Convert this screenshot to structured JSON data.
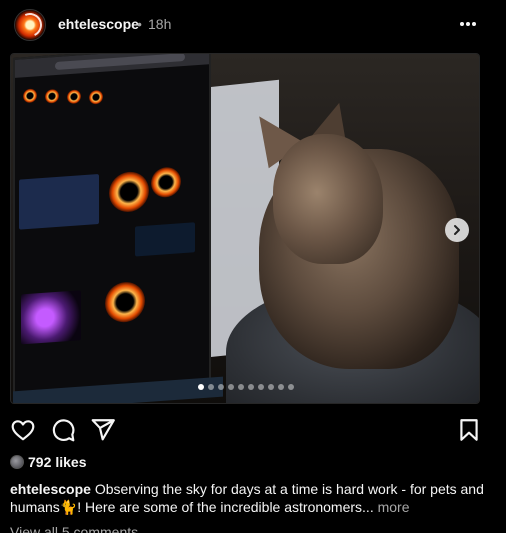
{
  "post": {
    "username": "ehtelescope",
    "separator": "•",
    "time": "18h",
    "likes_count": "792",
    "likes_word": "likes",
    "caption_username": "ehtelescope",
    "caption_text": "Observing the sky for days at a time is hard work - for pets and humans🐈! Here are some of the incredible astronomers...",
    "more_label": "more",
    "view_comments": "View all 5 comments"
  },
  "carousel": {
    "slide_count": 10,
    "active_index": 0
  },
  "colors": {
    "background": "#000000",
    "text": "#f5f5f5",
    "muted": "#a8a8a8"
  },
  "icons": {
    "like": "heart-icon",
    "comment": "comment-icon",
    "share": "paper-plane-icon",
    "save": "bookmark-icon",
    "more": "more-horizontal-icon",
    "next": "chevron-right-icon"
  }
}
